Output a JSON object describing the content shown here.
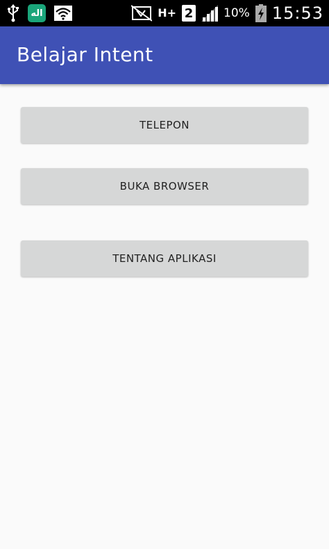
{
  "status_bar": {
    "icons_left": [
      "usb-icon",
      "app-notification-icon",
      "wifi-icon"
    ],
    "app_icon_glyph": "اله",
    "network_type": "H+",
    "sim_slot": "2",
    "battery_percent": "10%",
    "time": "15:53"
  },
  "app_bar": {
    "title": "Belajar Intent",
    "color": "#3f51b5"
  },
  "buttons": {
    "telepon": "TELEPON",
    "buka_browser": "BUKA BROWSER",
    "tentang_aplikasi": "TENTANG APLIKASI"
  }
}
